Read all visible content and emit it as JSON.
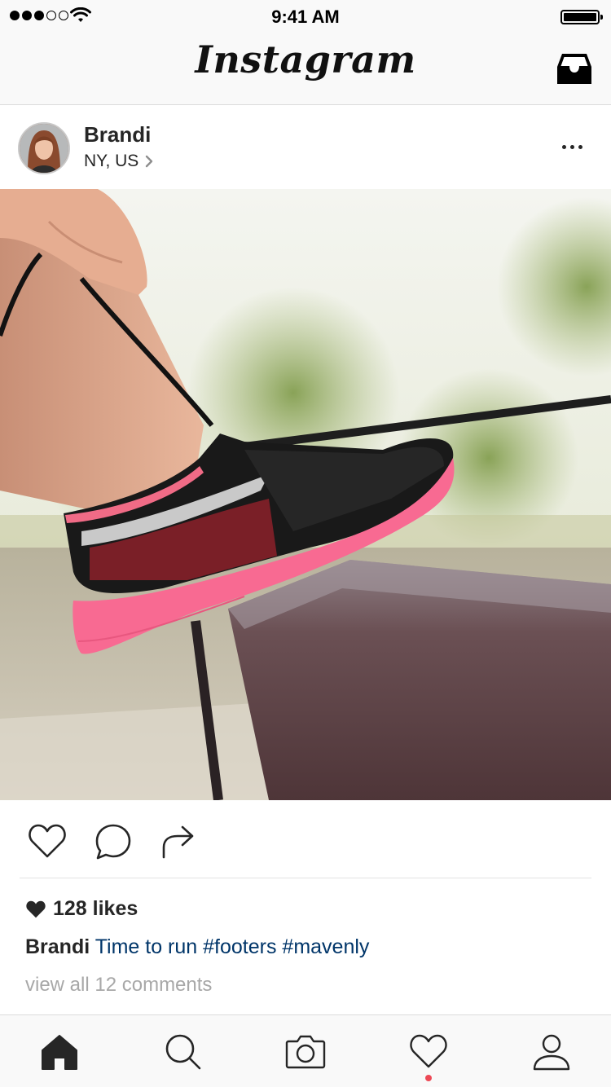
{
  "status_bar": {
    "time": "9:41 AM",
    "signal_bars_filled": 3,
    "signal_bars_total": 5,
    "icons": [
      "signal-dots-icon",
      "wifi-icon",
      "battery-icon"
    ]
  },
  "nav": {
    "logo": "Instagram",
    "icons": [
      "inbox-icon"
    ]
  },
  "post": {
    "username": "Brandi",
    "location": "NY, US",
    "icons": [
      "avatar",
      "chevron-right-icon",
      "more-options-icon"
    ],
    "photo_description_icon": "sneaker-photo",
    "actions": [
      "like-icon",
      "comment-icon",
      "share-icon"
    ],
    "likes": "128 likes",
    "caption_user": "Brandi",
    "caption_text": "Time to run #footers #mavenly",
    "view_comments": "view all 12 comments"
  },
  "tab_bar": {
    "tabs": [
      "home-icon",
      "search-icon",
      "camera-icon",
      "activity-heart-icon",
      "profile-icon"
    ],
    "active_tab": "home-icon"
  },
  "colors": {
    "link": "#003569",
    "muted": "#a8a8a8",
    "notification": "#ed4956",
    "bar_background": "#f9f9f9"
  }
}
